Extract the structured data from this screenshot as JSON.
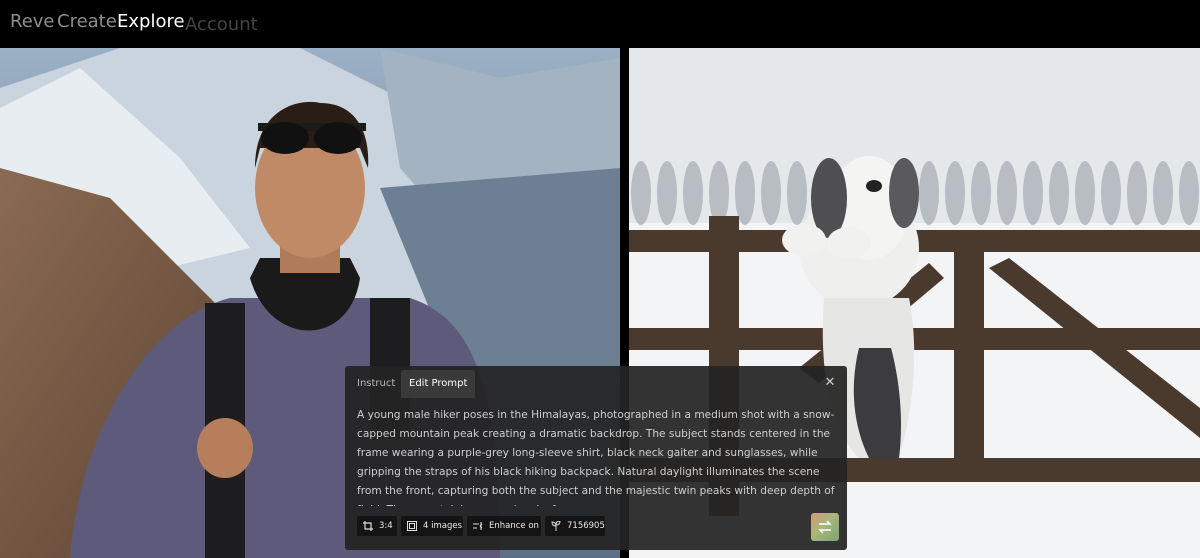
{
  "nav": {
    "brand": "Reve",
    "create": "Create",
    "explore": "Explore",
    "account": "Account"
  },
  "images": {
    "left_subject": "hiker-photo",
    "right_subject": "dog-photo"
  },
  "prompt_panel": {
    "tabs": [
      "Instruct",
      "Edit Prompt"
    ],
    "active_tab": "Edit Prompt",
    "close_icon": "close-icon",
    "text": "A young male hiker poses in the Himalayas, photographed in a medium shot with a snow-capped mountain peak creating a dramatic backdrop. The subject stands centered in the frame wearing a purple-grey long-sleeve shirt, black neck gaiter and sunglasses, while gripping the straps of his black hiking backpack. Natural daylight illuminates the scene from the front, capturing both the subject and the majestic twin peaks with deep depth of field. The mountain's exposed rocky faces...",
    "chips": {
      "aspect_ratio": "3:4",
      "image_count": "4 images",
      "enhance": "Enhance on",
      "seed": "7156905"
    },
    "swap_icon": "swap-icon"
  },
  "colors": {
    "background": "#000000",
    "panel": "#242424",
    "active_nav": "#ffffff",
    "inactive_nav": "#8d8d8d"
  }
}
